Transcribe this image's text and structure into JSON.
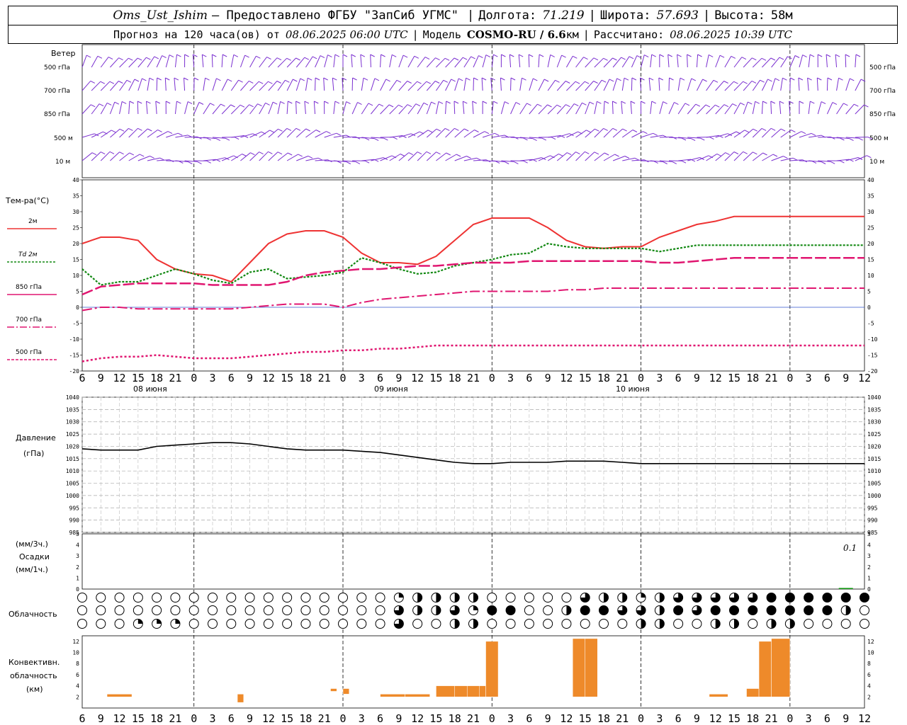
{
  "header": {
    "station": "Oms_Ust_Ishim",
    "provided": "– Предоставлено ФГБУ \"ЗапСиб УГМС\"",
    "lon_label": "Долгота:",
    "lon": "71.219",
    "lat_label": "Широта:",
    "lat": "57.693",
    "alt_label": "Высота:",
    "alt": "58м",
    "forecast_label": "Прогноз на 120 часа(ов) от",
    "forecast_start": "08.06.2025 06:00 UTC",
    "model_label": "Модель",
    "model": "COSMO-RU / 6.6",
    "model_unit": "км",
    "calc_label": "Рассчитано:",
    "calc_time": "08.06.2025 10:39 UTC"
  },
  "labels": {
    "wind_title": "Ветер",
    "wind_levels": [
      "500 гПа",
      "700 гПа",
      "850 гПа",
      "500 м",
      "10  м"
    ],
    "temp_title": "Тем-ра(°C)",
    "temp_legend": [
      "2м",
      "Td  2м",
      "850 гПа",
      "700 гПа",
      "500 гПа"
    ],
    "pressure_title": "Давление",
    "pressure_unit": "(гПа)",
    "precip_unit_3h": "(мм/3ч.)",
    "precip_title": "Осадки",
    "precip_unit_1h": "(мм/1ч.)",
    "precip_max": "0.1",
    "cloud_title": "Облачность",
    "conv_title_1": "Конвективн.",
    "conv_title_2": "облачность",
    "conv_unit": "(км)",
    "dates": [
      "08 июня",
      "09 июня",
      "10 июня"
    ]
  },
  "colors": {
    "t2m": "#ee3333",
    "td2m": "#118811",
    "t850": "#e01670",
    "t700": "#e01670",
    "t500": "#e01670",
    "wind": "#7a2fd0",
    "pressure": "#000000",
    "conv": "#ee8a2a",
    "precip": "#119911"
  },
  "chart_data": [
    {
      "type": "line",
      "name": "temperature",
      "x_hours": [
        0,
        3,
        6,
        9,
        12,
        15,
        18,
        21,
        24,
        27,
        30,
        33,
        36,
        39,
        42,
        45,
        48,
        51,
        54,
        57,
        60,
        63,
        66,
        69,
        72,
        75,
        78,
        81,
        84,
        87,
        90,
        93,
        96,
        99,
        102,
        105,
        108,
        111,
        114,
        117,
        120,
        123,
        126
      ],
      "x_tick_labels": [
        "6",
        "9",
        "12",
        "15",
        "18",
        "21",
        "0",
        "3",
        "6",
        "9",
        "12",
        "15",
        "18",
        "21",
        "0",
        "3",
        "6",
        "9",
        "12",
        "15",
        "18",
        "21",
        "0",
        "3",
        "6",
        "9",
        "12",
        "15",
        "18",
        "21",
        "0",
        "3",
        "6",
        "9",
        "12",
        "15",
        "18",
        "21",
        "0",
        "3",
        "6",
        "9",
        "12"
      ],
      "ylim": [
        -20,
        40
      ],
      "ylabel": "Тем-ра(°C)",
      "series": [
        {
          "name": "2м",
          "values": [
            20,
            22,
            22,
            21,
            15,
            12,
            10.5,
            10,
            8,
            14,
            20,
            23,
            24,
            24,
            22,
            17,
            14,
            14,
            13.5,
            16,
            21,
            26,
            28,
            28,
            28,
            25,
            21,
            19,
            18.5,
            19,
            19,
            22,
            24,
            26,
            27,
            28.5,
            28.5,
            28.5,
            28.5,
            28.5,
            28.5,
            28.5,
            28.5
          ]
        },
        {
          "name": "Td  2м",
          "values": [
            12,
            7,
            8,
            8,
            10,
            12,
            10.5,
            8.5,
            7.5,
            11,
            12,
            9,
            9.5,
            10,
            11,
            15.5,
            14,
            12,
            10.5,
            11,
            13,
            14,
            15,
            16.5,
            17,
            20,
            19,
            18.5,
            18.5,
            18.5,
            18.5,
            17.5,
            18.5,
            19.5,
            19.5,
            19.5,
            19.5,
            19.5,
            19.5,
            19.5,
            19.5,
            19.5,
            19.5
          ]
        },
        {
          "name": "850 гПа",
          "values": [
            4,
            6.5,
            7,
            7.5,
            7.5,
            7.5,
            7.5,
            7,
            7,
            7,
            7,
            8,
            10,
            11,
            11.5,
            12,
            12,
            12.5,
            13,
            13,
            13.5,
            14,
            14,
            14,
            14.5,
            14.5,
            14.5,
            14.5,
            14.5,
            14.5,
            14.5,
            14,
            14,
            14.5,
            15,
            15.5,
            15.5,
            15.5,
            15.5,
            15.5,
            15.5,
            15.5,
            15.5
          ]
        },
        {
          "name": "700 гПа",
          "values": [
            -1,
            0,
            0,
            -0.5,
            -0.5,
            -0.5,
            -0.5,
            -0.5,
            -0.5,
            0,
            0.5,
            1,
            1,
            1,
            0,
            1.5,
            2.5,
            3,
            3.5,
            4,
            4.5,
            5,
            5,
            5,
            5,
            5,
            5.5,
            5.5,
            6,
            6,
            6,
            6,
            6,
            6,
            6,
            6,
            6,
            6,
            6,
            6,
            6,
            6,
            6
          ]
        },
        {
          "name": "500 гПа",
          "values": [
            -17,
            -16,
            -15.5,
            -15.5,
            -15,
            -15.5,
            -16,
            -16,
            -16,
            -15.5,
            -15,
            -14.5,
            -14,
            -14,
            -13.5,
            -13.5,
            -13,
            -13,
            -12.5,
            -12,
            -12,
            -12,
            -12,
            -12,
            -12,
            -12,
            -12,
            -12,
            -12,
            -12,
            -12,
            -12,
            -12,
            -12,
            -12,
            -12,
            -12,
            -12,
            -12,
            -12,
            -12,
            -12,
            -12
          ]
        }
      ]
    },
    {
      "type": "line",
      "name": "pressure",
      "ylim": [
        985,
        1040
      ],
      "ylabel": "Давление (гПа)",
      "y_ticks": [
        1040,
        1035,
        1030,
        1025,
        1020,
        1015,
        1010,
        1005,
        1000,
        995,
        990,
        985
      ],
      "values": [
        1019,
        1018.5,
        1018.5,
        1018.5,
        1020,
        1020.5,
        1021,
        1021.5,
        1021.5,
        1021,
        1020,
        1019,
        1018.5,
        1018.5,
        1018.5,
        1018,
        1017.5,
        1016.5,
        1015.5,
        1014.5,
        1013.5,
        1013,
        1013,
        1013.5,
        1013.5,
        1013.5,
        1014,
        1014,
        1014,
        1013.5,
        1013,
        1013,
        1013,
        1013,
        1013,
        1013,
        1013,
        1013,
        1013,
        1013,
        1013,
        1013,
        1013
      ]
    },
    {
      "type": "bar",
      "name": "precipitation",
      "ylim": [
        0,
        5
      ],
      "y_ticks": [
        5,
        4,
        3,
        2,
        1,
        0
      ],
      "y_ticks_right": [
        5,
        4,
        3,
        2,
        1,
        0
      ],
      "values": [
        0,
        0,
        0,
        0,
        0,
        0,
        0,
        0,
        0,
        0,
        0,
        0,
        0,
        0,
        0,
        0,
        0,
        0,
        0,
        0,
        0,
        0,
        0,
        0,
        0,
        0,
        0,
        0,
        0,
        0,
        0,
        0,
        0,
        0,
        0,
        0,
        0,
        0,
        0,
        0,
        0,
        0.1,
        0
      ]
    },
    {
      "type": "bar",
      "name": "convective_cloud",
      "ylim": [
        0,
        13
      ],
      "y_ticks": [
        12,
        10,
        8,
        6,
        4,
        2
      ],
      "bars": [
        {
          "h_start": 4,
          "h_end": 8,
          "bottom": 2,
          "top": 2.5
        },
        {
          "h_start": 25,
          "h_end": 26,
          "bottom": 1,
          "top": 2.5
        },
        {
          "h_start": 40,
          "h_end": 41,
          "bottom": 3,
          "top": 3.5
        },
        {
          "h_start": 42,
          "h_end": 43,
          "bottom": 2.5,
          "top": 3.5
        },
        {
          "h_start": 48,
          "h_end": 52,
          "bottom": 2,
          "top": 2.5
        },
        {
          "h_start": 52,
          "h_end": 56,
          "bottom": 2,
          "top": 2.5
        },
        {
          "h_start": 57,
          "h_end": 60,
          "bottom": 2,
          "top": 4
        },
        {
          "h_start": 60,
          "h_end": 62,
          "bottom": 2,
          "top": 4
        },
        {
          "h_start": 62,
          "h_end": 64,
          "bottom": 2,
          "top": 4
        },
        {
          "h_start": 64,
          "h_end": 65,
          "bottom": 2,
          "top": 4
        },
        {
          "h_start": 65,
          "h_end": 67,
          "bottom": 2,
          "top": 12
        },
        {
          "h_start": 79,
          "h_end": 81,
          "bottom": 2,
          "top": 12.5
        },
        {
          "h_start": 81,
          "h_end": 83,
          "bottom": 2,
          "top": 12.5
        },
        {
          "h_start": 101,
          "h_end": 104,
          "bottom": 2,
          "top": 2.5
        },
        {
          "h_start": 107,
          "h_end": 109,
          "bottom": 2,
          "top": 3.5
        },
        {
          "h_start": 109,
          "h_end": 111,
          "bottom": 2,
          "top": 12
        },
        {
          "h_start": 111,
          "h_end": 114,
          "bottom": 2,
          "top": 12.5
        }
      ]
    },
    {
      "type": "table",
      "name": "cloud_cover",
      "rows": 3,
      "cols": 43,
      "fractions": [
        [
          0,
          0,
          0,
          0,
          0,
          0,
          0,
          0,
          0,
          0,
          0,
          0,
          0,
          0,
          0,
          0,
          0,
          0.25,
          0.5,
          0.5,
          0.5,
          0.5,
          0,
          0,
          0,
          0,
          0,
          0.75,
          0.5,
          0.5,
          0.25,
          0.5,
          0.75,
          0.75,
          0.75,
          0.75,
          0.75,
          1,
          1,
          1,
          1,
          1,
          1
        ],
        [
          0,
          0,
          0,
          0,
          0,
          0,
          0,
          0,
          0,
          0,
          0,
          0,
          0,
          0,
          0,
          0,
          0,
          0.75,
          0.5,
          0.5,
          0.75,
          0.25,
          1,
          1,
          0,
          0,
          0.5,
          1,
          1,
          0.75,
          0.75,
          0.5,
          1,
          0.75,
          1,
          1,
          1,
          1,
          1,
          1,
          1,
          0.5,
          0
        ],
        [
          0,
          0,
          0,
          0.25,
          0.25,
          0.25,
          0,
          0,
          0,
          0,
          0,
          0,
          0,
          0,
          0,
          0,
          0,
          0.75,
          0,
          0,
          0.5,
          0.5,
          0,
          0,
          0,
          0,
          0,
          0,
          0,
          0,
          0.5,
          0.5,
          0,
          0,
          0.5,
          0.5,
          0,
          0.5,
          0.5,
          0,
          0,
          0,
          0
        ]
      ]
    }
  ],
  "wind_barb_rows": 5
}
